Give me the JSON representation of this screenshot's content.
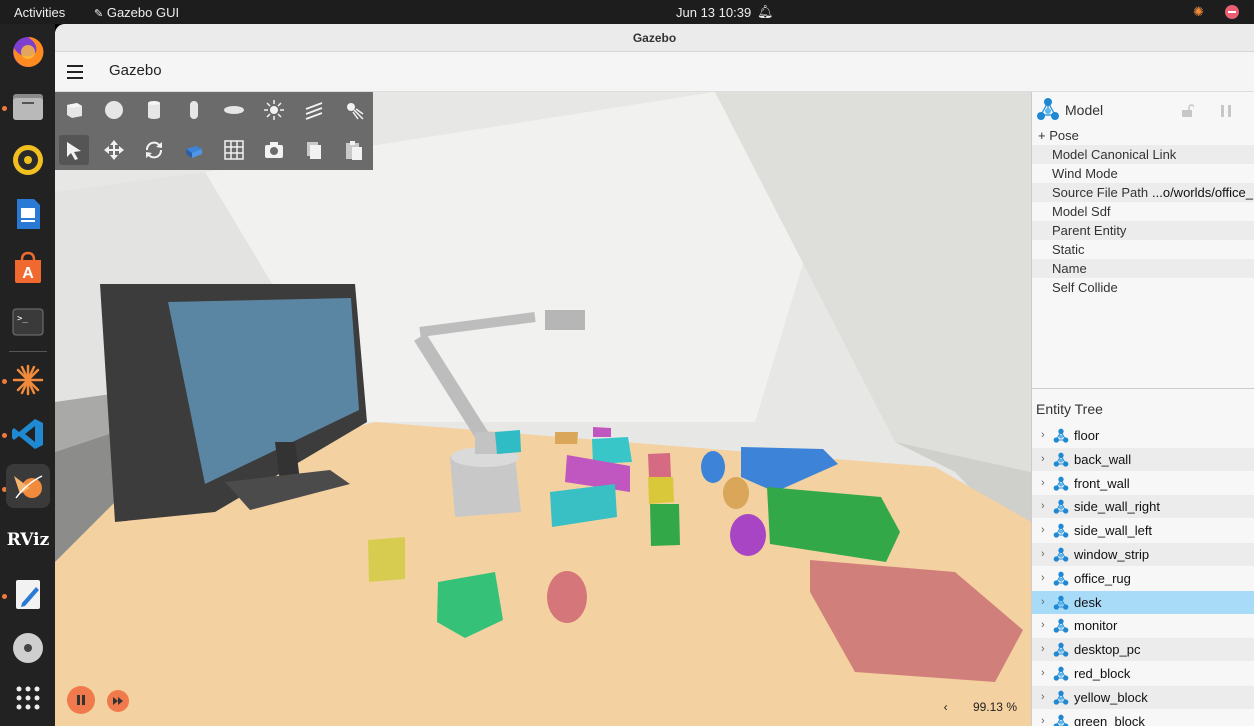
{
  "topbar": {
    "activities": "Activities",
    "app_name": "Gazebo GUI",
    "datetime": "Jun 13  10:39"
  },
  "window": {
    "title": "Gazebo"
  },
  "appbar": {
    "title": "Gazebo"
  },
  "toolbar": {
    "row1": [
      "box-shape-icon",
      "sphere-shape-icon",
      "cylinder-shape-icon",
      "capsule-shape-icon",
      "ellipsoid-shape-icon",
      "point-light-icon",
      "directional-light-icon",
      "spot-light-icon"
    ],
    "row2": [
      "select-mode-icon",
      "translate-mode-icon",
      "rotate-mode-icon",
      "view-angle-icon",
      "grid-icon",
      "screenshot-icon",
      "copy-icon",
      "paste-icon"
    ]
  },
  "viewport": {
    "rtf_arrow": "‹",
    "real_time_factor": "99.13 %"
  },
  "component_inspector": {
    "header": "Model",
    "rows": [
      {
        "key": "+ Pose",
        "value": ""
      },
      {
        "key": "Model Canonical Link",
        "value": ""
      },
      {
        "key": "Wind Mode",
        "value": ""
      },
      {
        "key": "Source File Path",
        "value": "...o/worlds/office_"
      },
      {
        "key": "Model Sdf",
        "value": ""
      },
      {
        "key": "Parent Entity",
        "value": ""
      },
      {
        "key": "Static",
        "value": ""
      },
      {
        "key": "Name",
        "value": ""
      },
      {
        "key": "Self Collide",
        "value": ""
      }
    ]
  },
  "entity_tree": {
    "header": "Entity Tree",
    "items": [
      {
        "label": "floor"
      },
      {
        "label": "back_wall"
      },
      {
        "label": "front_wall"
      },
      {
        "label": "side_wall_right"
      },
      {
        "label": "side_wall_left"
      },
      {
        "label": "window_strip"
      },
      {
        "label": "office_rug"
      },
      {
        "label": "desk",
        "selected": true
      },
      {
        "label": "monitor"
      },
      {
        "label": "desktop_pc"
      },
      {
        "label": "red_block"
      },
      {
        "label": "yellow_block"
      },
      {
        "label": "green_block"
      }
    ]
  },
  "dock": {
    "items": [
      "firefox-icon",
      "files-icon",
      "rhythmbox-icon",
      "writer-icon",
      "app-center-icon",
      "terminal-icon",
      "gazebo-sun-icon",
      "vscode-icon",
      "gazebo-icon",
      "rviz-icon",
      "text-editor-icon",
      "disc-icon",
      "app-grid-icon"
    ],
    "rviz_label": "RViz"
  },
  "colors": {
    "accent": "#f07a4c",
    "selection": "#a8dbf7"
  }
}
